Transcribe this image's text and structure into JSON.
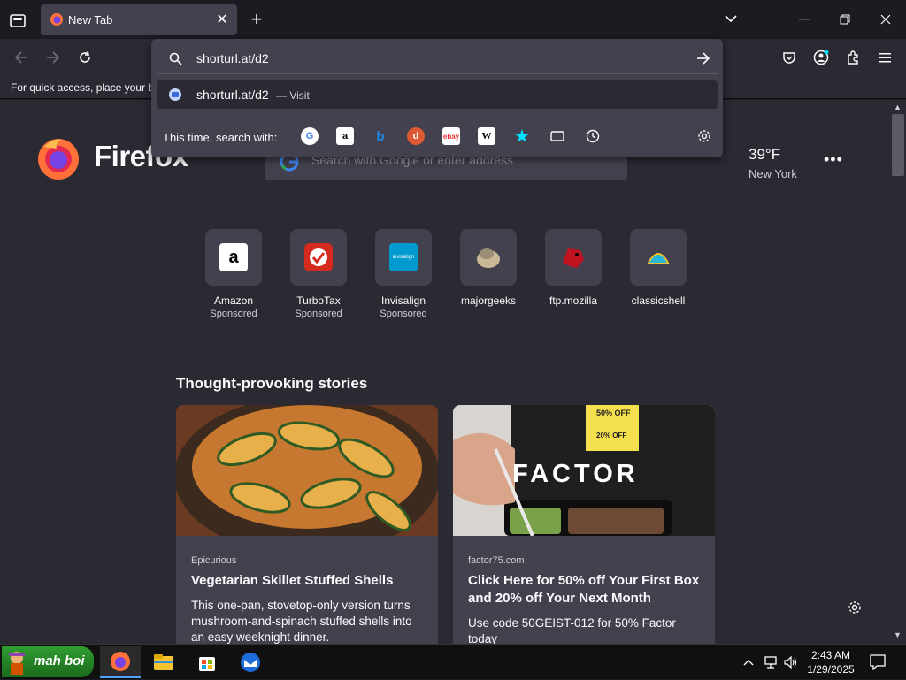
{
  "window": {
    "tab_title": "New Tab",
    "new_tab_symbol": "+",
    "list_tabs_symbol": "⌄",
    "close_tab_symbol": "✕"
  },
  "url_panel": {
    "typed": "shorturl.at/d2",
    "suggestion_url": "shorturl.at/d2",
    "suggestion_action": "— Visit",
    "search_with_label": "This time, search with:",
    "engines": [
      "google-icon",
      "amazon-icon",
      "bing-icon",
      "duckduckgo-icon",
      "ebay-icon",
      "wikipedia-icon",
      "bookmarks-star-icon",
      "tabs-icon",
      "history-icon"
    ]
  },
  "bookmarks_bar": {
    "message": "For quick access, place your bo"
  },
  "newtab": {
    "brand": "Firefox",
    "search_placeholder": "Search with Google or enter address",
    "weather_temp": "39°F",
    "weather_city": "New York",
    "menu_dots": "•••"
  },
  "shortcuts": [
    {
      "label": "Amazon",
      "sub": "Sponsored"
    },
    {
      "label": "TurboTax",
      "sub": "Sponsored"
    },
    {
      "label": "Invisalign",
      "sub": "Sponsored"
    },
    {
      "label": "majorgeeks",
      "sub": ""
    },
    {
      "label": "ftp.mozilla",
      "sub": ""
    },
    {
      "label": "classicshell",
      "sub": ""
    }
  ],
  "stories": {
    "heading": "Thought-provoking stories",
    "cards": [
      {
        "source": "Epicurious",
        "title": "Vegetarian Skillet Stuffed Shells",
        "desc": "This one-pan, stovetop-only version turns mushroom-and-spinach stuffed shells into an easy weeknight dinner."
      },
      {
        "source": "factor75.com",
        "title": "Click Here for 50% off Your First Box and 20% off Your Next Month",
        "desc": "Use code 50GEIST-012 for 50% Factor today"
      }
    ],
    "factor_word": "FACTOR",
    "factor_promo1": "50% OFF",
    "factor_promo2": "20% OFF"
  },
  "taskbar": {
    "start_label": "mah boi",
    "time": "2:43 AM",
    "date": "1/29/2025"
  },
  "colors": {
    "chrome": "#2b2a33",
    "panel": "#42414d",
    "accent": "#00ddff"
  }
}
